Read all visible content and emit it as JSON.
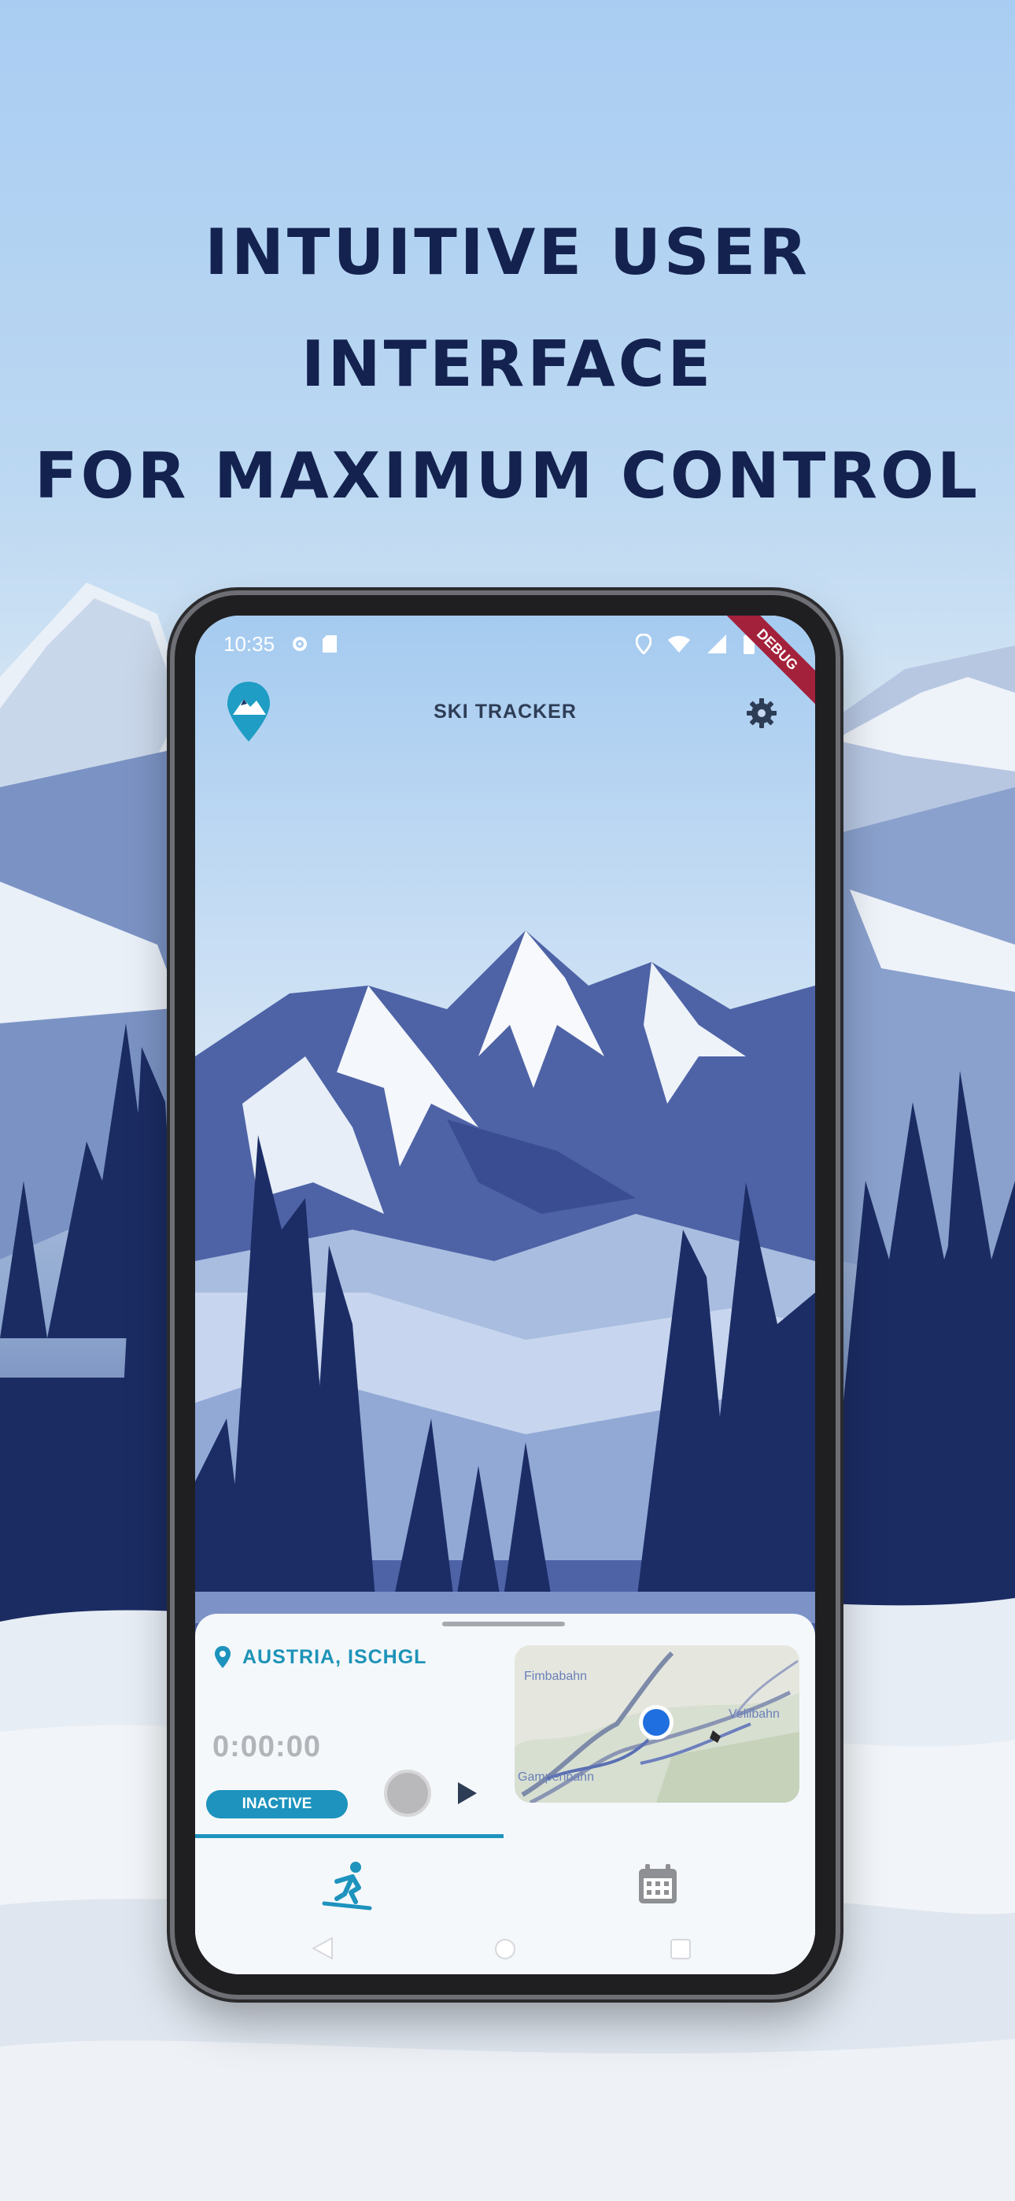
{
  "headline": {
    "line1": "INTUITIVE USER INTERFACE",
    "line2": "FOR MAXIMUM CONTROL"
  },
  "status_bar": {
    "time": "10:35",
    "left_icons": [
      "gear-icon",
      "sim-card-icon"
    ],
    "right_icons": [
      "location-pin-icon",
      "wifi-icon",
      "signal-icon",
      "battery-icon"
    ],
    "debug_label": "DEBUG"
  },
  "app_bar": {
    "title": "SKI TRACKER",
    "logo_icon": "mountain-pin-logo",
    "settings_icon": "gear-icon"
  },
  "tracker": {
    "location": "AUSTRIA, ISCHGL",
    "elapsed": "0:00:00",
    "status": "INACTIVE",
    "record_icon": "record-icon",
    "play_icon": "play-icon"
  },
  "mini_map": {
    "labels": [
      "Fimbabahn",
      "Velilbahn",
      "Gampenbahn"
    ]
  },
  "nav": {
    "items": [
      {
        "icon": "skier-icon",
        "active": true
      },
      {
        "icon": "calendar-icon",
        "active": false
      }
    ]
  },
  "colors": {
    "accent": "#1d93bd",
    "headline": "#14224f",
    "title": "#2e3d56"
  }
}
